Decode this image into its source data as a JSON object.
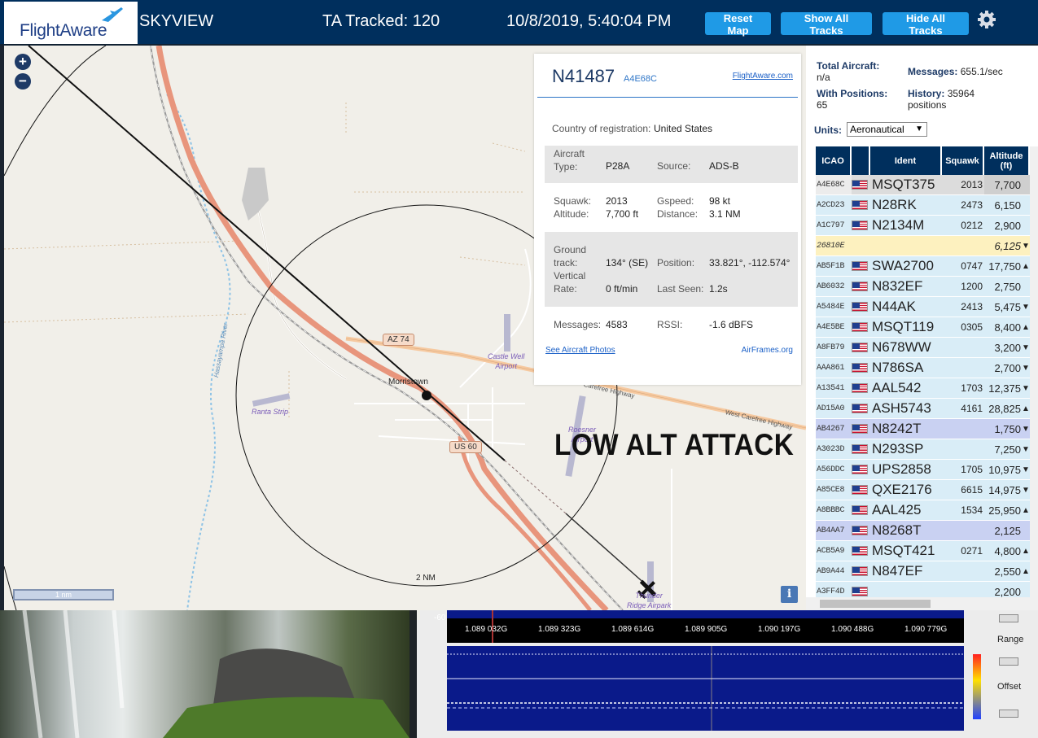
{
  "header": {
    "brand": "FlightAware",
    "site_name": "SKYVIEW",
    "tracked": "TA Tracked: 120",
    "datetime": "10/8/2019, 5:40:04 PM",
    "reset_label": "Reset Map",
    "show_label": "Show All Tracks",
    "hide_label": "Hide All Tracks"
  },
  "map": {
    "overlay_text": "LOW ALT ATTACK",
    "range_label": "2 NM",
    "scale_label": "1 nm",
    "town": "Morristown",
    "road_az74": "AZ 74",
    "road_us60": "US 60",
    "highway1": "Carefree Highway",
    "highway2": "West Carefree Highway",
    "river": "Hassayampa River",
    "airports": [
      "Castle Well",
      "Airport",
      "Ranta Strip",
      "Roesner",
      "Airport",
      "Thunder",
      "Ridge Airpark"
    ],
    "info": "i"
  },
  "popup": {
    "ident": "N41487",
    "hex": "A4E68C",
    "fa_link": "FlightAware.com",
    "country_label": "Country of registration:",
    "country": "United States",
    "type_label": "Aircraft Type:",
    "type": "P28A",
    "source_label": "Source:",
    "source": "ADS-B",
    "squawk_label": "Squawk:",
    "squawk": "2013",
    "altitude_label": "Altitude:",
    "altitude": "7,700 ft",
    "gspeed_label": "Gspeed:",
    "gspeed": "98 kt",
    "distance_label": "Distance:",
    "distance": "3.1 NM",
    "track_label_1": "Ground",
    "track_label_2": "track:",
    "track": "134° (SE)",
    "position_label": "Position:",
    "position": "33.821°, -112.574°",
    "vrate_label_1": "Vertical",
    "vrate_label_2": "Rate:",
    "vrate": "0 ft/min",
    "lastseen_label": "Last Seen:",
    "lastseen": "1.2s",
    "messages_label": "Messages:",
    "messages": "4583",
    "rssi_label": "RSSI:",
    "rssi": "-1.6 dBFS",
    "photos_link": "See Aircraft Photos",
    "airframes_link": "AirFrames.org"
  },
  "panel": {
    "total_label": "Total Aircraft:",
    "total": "n/a",
    "messages_label": "Messages:",
    "messages": "655.1/sec",
    "withpos_label": "With Positions:",
    "withpos": "65",
    "history_label": "History:",
    "history_1": "35964",
    "history_2": "positions",
    "units_label": "Units:",
    "units_value": "Aeronautical",
    "columns": [
      "ICAO",
      "Ident",
      "Squawk",
      "Altitude (ft)"
    ]
  },
  "rows": [
    {
      "icao": "A4E68C",
      "ident": "MSQT375",
      "squawk": "2013",
      "alt": "7,700",
      "trend": "",
      "flag": true,
      "style": "selected"
    },
    {
      "icao": "A2CD23",
      "ident": "N28RK",
      "squawk": "2473",
      "alt": "6,150",
      "trend": "",
      "flag": true,
      "style": "normal"
    },
    {
      "icao": "A1C797",
      "ident": "N2134M",
      "squawk": "0212",
      "alt": "2,900",
      "trend": "",
      "flag": true,
      "style": "normal"
    },
    {
      "icao": "26810E",
      "ident": "",
      "squawk": "",
      "alt": "6,125",
      "trend": "▼",
      "flag": false,
      "style": "mlat"
    },
    {
      "icao": "AB5F1B",
      "ident": "SWA2700",
      "squawk": "0747",
      "alt": "17,750",
      "trend": "▲",
      "flag": true,
      "style": "normal"
    },
    {
      "icao": "AB6032",
      "ident": "N832EF",
      "squawk": "1200",
      "alt": "2,750",
      "trend": "",
      "flag": true,
      "style": "normal"
    },
    {
      "icao": "A5484E",
      "ident": "N44AK",
      "squawk": "2413",
      "alt": "5,475",
      "trend": "▼",
      "flag": true,
      "style": "normal"
    },
    {
      "icao": "A4E5BE",
      "ident": "MSQT119",
      "squawk": "0305",
      "alt": "8,400",
      "trend": "▲",
      "flag": true,
      "style": "normal"
    },
    {
      "icao": "A8FB79",
      "ident": "N678WW",
      "squawk": "",
      "alt": "3,200",
      "trend": "▼",
      "flag": true,
      "style": "normal"
    },
    {
      "icao": "AAA861",
      "ident": "N786SA",
      "squawk": "",
      "alt": "2,700",
      "trend": "▼",
      "flag": true,
      "style": "normal"
    },
    {
      "icao": "A13541",
      "ident": "AAL542",
      "squawk": "1703",
      "alt": "12,375",
      "trend": "▼",
      "flag": true,
      "style": "normal"
    },
    {
      "icao": "AD15A0",
      "ident": "ASH5743",
      "squawk": "4161",
      "alt": "28,825",
      "trend": "▲",
      "flag": true,
      "style": "normal"
    },
    {
      "icao": "AB4267",
      "ident": "N8242T",
      "squawk": "",
      "alt": "1,750",
      "trend": "▼",
      "flag": true,
      "style": "tisb"
    },
    {
      "icao": "A3023D",
      "ident": "N293SP",
      "squawk": "",
      "alt": "7,250",
      "trend": "▼",
      "flag": true,
      "style": "normal"
    },
    {
      "icao": "A56DDC",
      "ident": "UPS2858",
      "squawk": "1705",
      "alt": "10,975",
      "trend": "▼",
      "flag": true,
      "style": "normal"
    },
    {
      "icao": "A85CE8",
      "ident": "QXE2176",
      "squawk": "6615",
      "alt": "14,975",
      "trend": "▼",
      "flag": true,
      "style": "normal"
    },
    {
      "icao": "A8BBBC",
      "ident": "AAL425",
      "squawk": "1534",
      "alt": "25,950",
      "trend": "▲",
      "flag": true,
      "style": "normal"
    },
    {
      "icao": "AB4AA7",
      "ident": "N8268T",
      "squawk": "",
      "alt": "2,125",
      "trend": "",
      "flag": true,
      "style": "tisb"
    },
    {
      "icao": "ACB5A9",
      "ident": "MSQT421",
      "squawk": "0271",
      "alt": "4,800",
      "trend": "▲",
      "flag": true,
      "style": "normal"
    },
    {
      "icao": "AB9A44",
      "ident": "N847EF",
      "squawk": "",
      "alt": "2,550",
      "trend": "▲",
      "flag": true,
      "style": "normal"
    },
    {
      "icao": "A3FF4D",
      "ident": "",
      "squawk": "",
      "alt": "2,200",
      "trend": "",
      "flag": true,
      "style": "normal"
    }
  ],
  "row_colors": {
    "normal": "#d9edf7",
    "selected": "#dcdcdc",
    "mlat": "#fdf1bf",
    "tisb": "#c9d1f2"
  },
  "sdr": {
    "db_label": "-60",
    "freqs": [
      "1.089 032G",
      "1.089 323G",
      "1.089 614G",
      "1.089 905G",
      "1.090 197G",
      "1.090 488G",
      "1.090 779G"
    ],
    "range_label": "Range",
    "offset_label": "Offset"
  }
}
